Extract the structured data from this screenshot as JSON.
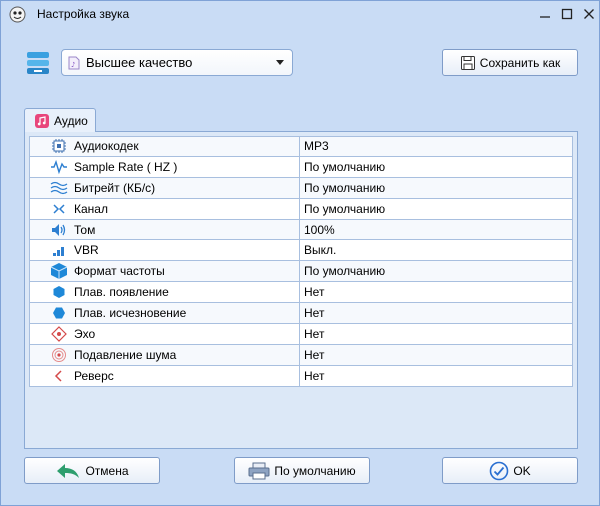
{
  "window": {
    "title": "Настройка звука"
  },
  "preset": {
    "selected": "Высшее качество"
  },
  "toolbar": {
    "save_as_label": "Сохранить как"
  },
  "tabs": [
    {
      "label": "Аудио"
    }
  ],
  "properties": [
    {
      "name": "Аудиокодек",
      "value": "MP3",
      "icon": "codec-chip-icon"
    },
    {
      "name": "Sample Rate ( HZ )",
      "value": "По умолчанию",
      "icon": "sample-rate-icon"
    },
    {
      "name": "Битрейт (КБ/с)",
      "value": "По умолчанию",
      "icon": "bitrate-wave-icon"
    },
    {
      "name": "Канал",
      "value": "По умолчанию",
      "icon": "channel-arrows-icon"
    },
    {
      "name": "Том",
      "value": "100%",
      "icon": "speaker-volume-icon"
    },
    {
      "name": "VBR",
      "value": "Выкл.",
      "icon": "vbr-bars-icon"
    },
    {
      "name": "Формат частоты",
      "value": "По умолчанию",
      "icon": "cube-icon"
    },
    {
      "name": "Плав. появление",
      "value": "Нет",
      "icon": "fade-in-hexagon-icon"
    },
    {
      "name": "Плав. исчезновение",
      "value": "Нет",
      "icon": "fade-out-hexagon-icon"
    },
    {
      "name": "Эхо",
      "value": "Нет",
      "icon": "echo-icon"
    },
    {
      "name": "Подавление шума",
      "value": "Нет",
      "icon": "noise-target-icon"
    },
    {
      "name": "Реверс",
      "value": "Нет",
      "icon": "reverse-arrow-icon"
    }
  ],
  "footer": {
    "cancel_label": "Отмена",
    "default_label": "По умолчанию",
    "ok_label": "OK"
  },
  "colors": {
    "background": "#c9dcf5",
    "border": "#8aa9d4",
    "accent_green": "#2e9e6e",
    "accent_blue": "#2a6fd1",
    "tab_icon": "#e8467c"
  }
}
